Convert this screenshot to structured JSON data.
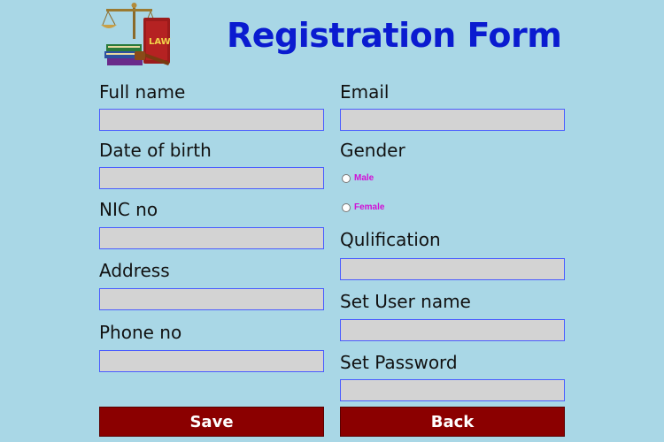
{
  "page_title": "Registration Form",
  "logo": {
    "icon": "law-scales-books-logo",
    "badge_text": "LAW"
  },
  "colors": {
    "background": "#a9d7e6",
    "title": "#0a1bd0",
    "button": "#8b0000",
    "radio_label": "#d10fd6"
  },
  "left_column": {
    "full_name_label": "Full name",
    "full_name_value": "",
    "dob_label": "Date of birth",
    "dob_value": "",
    "nic_label": "NIC no",
    "nic_value": "",
    "address_label": "Address",
    "address_value": "",
    "phone_label": "Phone no",
    "phone_value": ""
  },
  "right_column": {
    "email_label": "Email",
    "email_value": "",
    "gender_label": "Gender",
    "gender_options": [
      "Male",
      "Female"
    ],
    "qualification_label": "Qulification",
    "qualification_value": "",
    "username_label": "Set User name",
    "username_value": "",
    "password_label": "Set Password",
    "password_value": ""
  },
  "buttons": {
    "save": "Save",
    "back": "Back"
  }
}
